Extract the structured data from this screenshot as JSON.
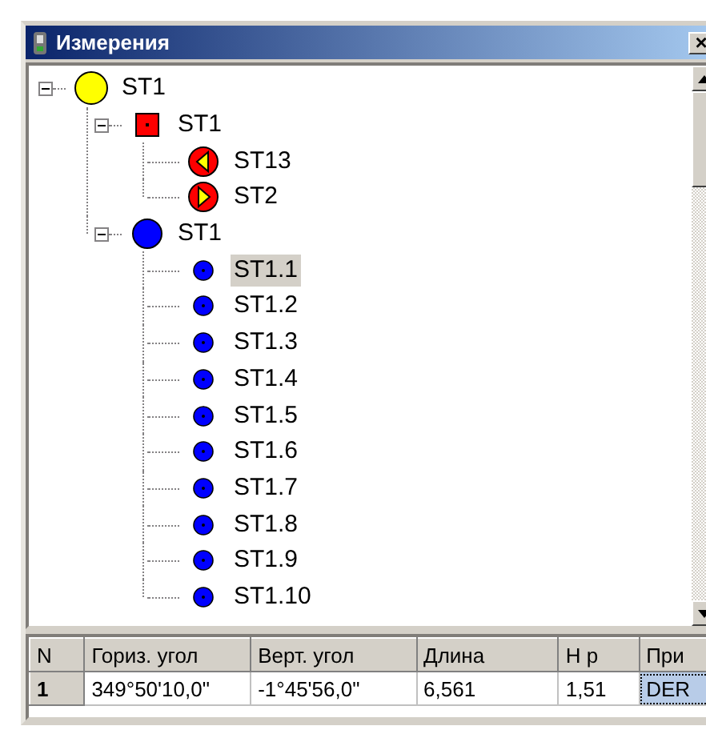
{
  "window": {
    "title": "Измерения",
    "close": "×"
  },
  "tree": [
    {
      "label": "ST1",
      "kind": "station",
      "expanded": true,
      "selected": false,
      "children": [
        {
          "label": "ST1",
          "kind": "setup",
          "expanded": true,
          "selected": false,
          "children": [
            {
              "label": "ST13",
              "kind": "backsight",
              "selected": false
            },
            {
              "label": "ST2",
              "kind": "foresight",
              "selected": false
            }
          ]
        },
        {
          "label": "ST1",
          "kind": "group",
          "expanded": true,
          "selected": false,
          "children": [
            {
              "label": "ST1.1",
              "kind": "point",
              "selected": true
            },
            {
              "label": "ST1.2",
              "kind": "point",
              "selected": false
            },
            {
              "label": "ST1.3",
              "kind": "point",
              "selected": false
            },
            {
              "label": "ST1.4",
              "kind": "point",
              "selected": false
            },
            {
              "label": "ST1.5",
              "kind": "point",
              "selected": false
            },
            {
              "label": "ST1.6",
              "kind": "point",
              "selected": false
            },
            {
              "label": "ST1.7",
              "kind": "point",
              "selected": false
            },
            {
              "label": "ST1.8",
              "kind": "point",
              "selected": false
            },
            {
              "label": "ST1.9",
              "kind": "point",
              "selected": false
            },
            {
              "label": "ST1.10",
              "kind": "point",
              "selected": false
            }
          ]
        }
      ]
    }
  ],
  "table": {
    "columns": [
      "N",
      "Гориз. угол",
      "Верт. угол",
      "Длина",
      "H p",
      "При"
    ],
    "rows": [
      {
        "cells": [
          {
            "text": "1",
            "selected": false
          },
          {
            "text": "349°50'10,0\"",
            "selected": false
          },
          {
            "text": "-1°45'56,0\"",
            "selected": false
          },
          {
            "text": "6,561",
            "selected": false
          },
          {
            "text": "1,51",
            "selected": false
          },
          {
            "text": "DER",
            "selected": true
          }
        ]
      }
    ]
  }
}
